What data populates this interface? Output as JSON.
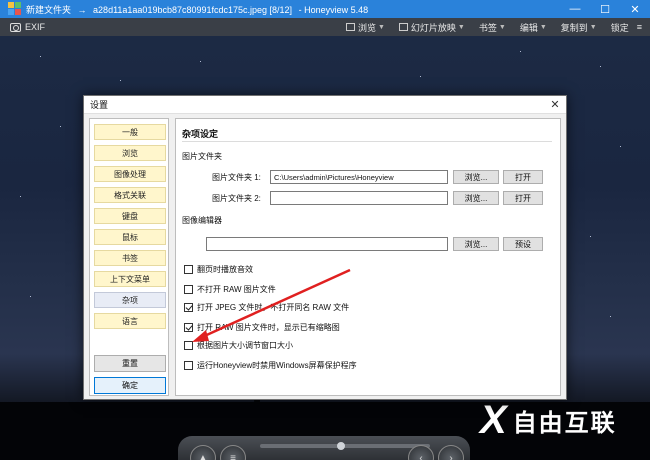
{
  "window": {
    "folder": "新建文件夹",
    "separator": "→",
    "filename": "a28d11a1aa019bcb87c80991fcdc175c.jpeg [8/12]",
    "app": "- Honeyview 5.48",
    "controls": {
      "minimize": "—",
      "maximize": "☐",
      "close": "✕"
    }
  },
  "toolbar": {
    "exif": "EXIF",
    "items": [
      {
        "label": "浏览",
        "icon": "browse-icon"
      },
      {
        "label": "幻灯片放映",
        "icon": "slideshow-icon"
      },
      {
        "label": "书签",
        "icon": "bookmark-icon"
      },
      {
        "label": "编辑",
        "icon": "edit-icon"
      },
      {
        "label": "复制到",
        "icon": "copy-to-icon"
      },
      {
        "label": "锁定",
        "icon": "lock-icon"
      }
    ]
  },
  "dialog": {
    "title": "设置",
    "close": "✕",
    "sidebar": {
      "items": [
        "一般",
        "浏览",
        "图像处理",
        "格式关联",
        "键盘",
        "鼠标",
        "书签",
        "上下文菜单",
        "杂项",
        "语言"
      ],
      "selected": "杂项",
      "reset_label": "重置",
      "ok_label": "确定"
    },
    "misc": {
      "section_title": "杂项设定",
      "image_folders_heading": "图片文件夹",
      "folder1_label": "图片文件夹 1:",
      "folder1_value": "C:\\Users\\admin\\Pictures\\Honeyview",
      "folder2_label": "图片文件夹 2:",
      "folder2_value": "",
      "browse_label": "浏览...",
      "open_label": "打开",
      "editor_heading": "图像编辑器",
      "editor_value": "",
      "preset_label": "预设",
      "checkboxes": [
        {
          "label": "翻页时播放音效",
          "checked": false
        },
        {
          "label": "不打开 RAW 图片文件",
          "checked": false
        },
        {
          "label": "打开 JPEG 文件时，不打开同名 RAW 文件",
          "checked": true
        },
        {
          "label": "打开 RAW 图片文件时，显示已有缩略图",
          "checked": true
        },
        {
          "label": "根据图片大小调节窗口大小",
          "checked": false
        },
        {
          "label": "运行Honeyview时禁用Windows屏幕保护程序",
          "checked": false
        }
      ]
    }
  },
  "watermark": {
    "mark": "X",
    "text": "自由互联"
  },
  "colors": {
    "titlebar": "#2a82da",
    "toolbar": "#3a3f47",
    "annotation_arrow": "#e02020"
  }
}
